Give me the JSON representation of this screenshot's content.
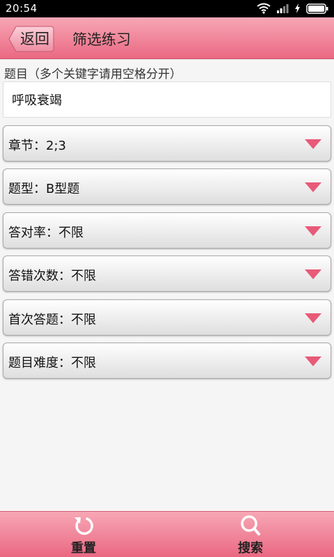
{
  "status_bar": {
    "time": "20:54"
  },
  "header": {
    "back_label": "返回",
    "title": "筛选练习"
  },
  "keyword": {
    "label": "题目（多个关键字请用空格分开）",
    "value": "呼吸衰竭"
  },
  "filters": [
    {
      "label": "章节：2;3"
    },
    {
      "label": "题型：B型题"
    },
    {
      "label": "答对率：不限"
    },
    {
      "label": "答错次数：不限"
    },
    {
      "label": "首次答题：不限"
    },
    {
      "label": "题目难度：不限"
    }
  ],
  "bottom_bar": {
    "reset_label": "重置",
    "search_label": "搜索"
  },
  "colors": {
    "accent": "#e85a78",
    "header_top": "#f7a7b5",
    "header_bottom": "#ea6882"
  },
  "icons": {
    "back": "back-arrow-icon",
    "caret": "caret-down-icon",
    "reset": "refresh-icon",
    "search": "search-icon"
  }
}
